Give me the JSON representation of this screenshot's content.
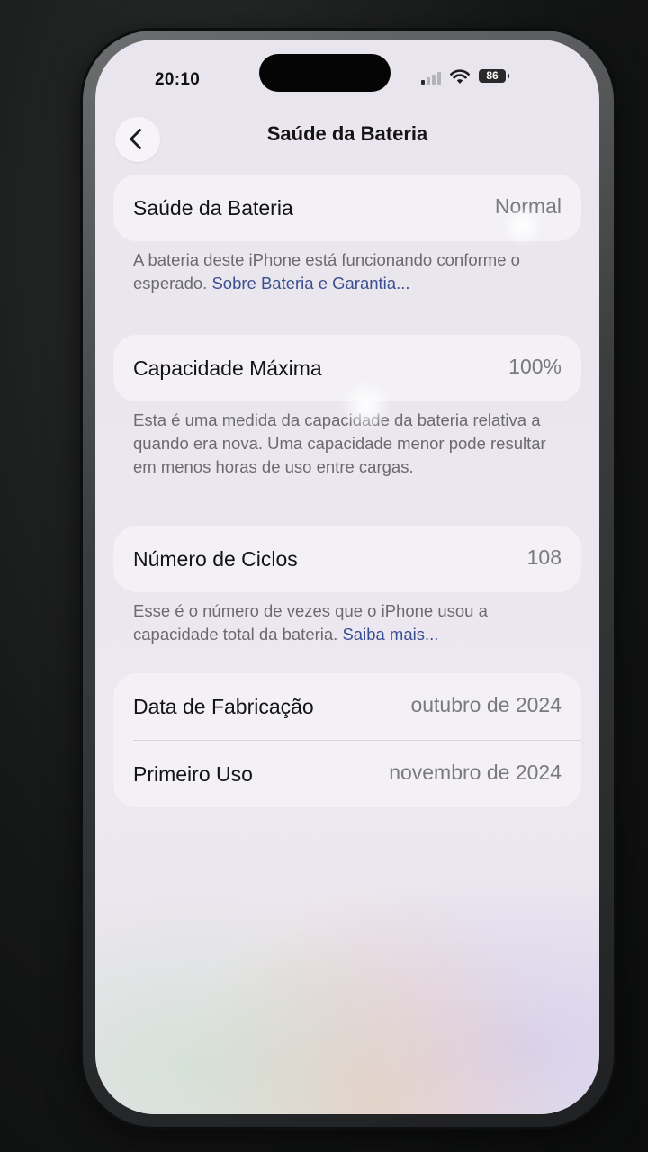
{
  "status_bar": {
    "time": "20:10",
    "battery_percent": "86",
    "icons": [
      "cellular-signal-icon",
      "wifi-icon",
      "battery-icon"
    ]
  },
  "nav": {
    "back_icon": "chevron-left-icon",
    "title": "Saúde da Bateria"
  },
  "battery_health": {
    "label": "Saúde da Bateria",
    "value": "Normal",
    "note_text": "A bateria deste iPhone está funcionando conforme o esperado. ",
    "note_link": "Sobre Bateria e Garantia..."
  },
  "max_capacity": {
    "label": "Capacidade Máxima",
    "value": "100%",
    "note_text": "Esta é uma medida da capacidade da bateria relativa a quando era nova. Uma capacidade menor pode resultar em menos horas de uso entre cargas."
  },
  "cycle_count": {
    "label": "Número de Ciclos",
    "value": "108",
    "note_text": "Esse é o número de vezes que o iPhone usou a capacidade total da bateria. ",
    "note_link": "Saiba mais..."
  },
  "dates": {
    "manufacture_label": "Data de Fabricação",
    "manufacture_value": "outubro de 2024",
    "first_use_label": "Primeiro Uso",
    "first_use_value": "novembro de 2024"
  },
  "colors": {
    "link": "#3a4f8f",
    "secondary_text": "#7a7a7e",
    "card_bg": "#f3f1f5"
  }
}
